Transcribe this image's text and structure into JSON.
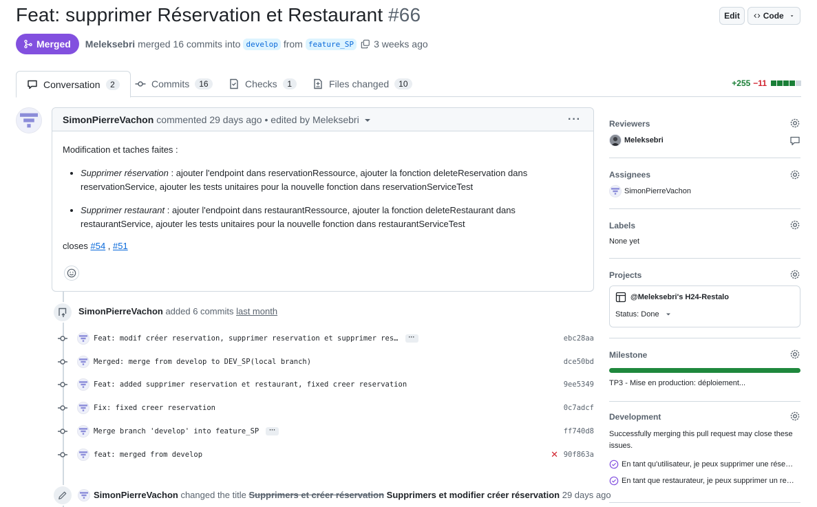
{
  "header": {
    "title": "Feat: supprimer Réservation et Restaurant",
    "number": "#66",
    "edit_label": "Edit",
    "code_label": "Code"
  },
  "pr_meta": {
    "state": "Merged",
    "author": "Meleksebri",
    "merged_text": "merged 16 commits into",
    "base_branch": "develop",
    "from_text": "from",
    "head_branch": "feature_SP",
    "time": "3 weeks ago"
  },
  "tabs": [
    {
      "label": "Conversation",
      "count": "2",
      "icon": "comment-icon",
      "active": true
    },
    {
      "label": "Commits",
      "count": "16",
      "icon": "commit-icon"
    },
    {
      "label": "Checks",
      "count": "1",
      "icon": "checklist-icon"
    },
    {
      "label": "Files changed",
      "count": "10",
      "icon": "file-diff-icon"
    }
  ],
  "diffstat": {
    "additions": "+255",
    "deletions": "−11"
  },
  "comment": {
    "author": "SimonPierreVachon",
    "action": "commented 29 days ago",
    "edited": "• edited by Meleksebri",
    "intro": "Modification et taches faites :",
    "items": [
      {
        "title": "Supprimer réservation",
        "text": " : ajouter l'endpoint dans reservationRessource, ajouter la fonction deleteReservation dans reservationService, ajouter les tests unitaires pour la nouvelle fonction dans reservationServiceTest"
      },
      {
        "title": "Supprimer restaurant",
        "text": " : ajouter l'endpoint dans restaurantRessource, ajouter la fonction deleteRestaurant dans restaurantService, ajouter les tests unitaires pour la nouvelle fonction dans restaurantServiceTest"
      }
    ],
    "closes_label": "closes",
    "issue1": "#54",
    "issue2": "#51"
  },
  "commits_event": {
    "author": "SimonPierreVachon",
    "text": "added 6 commits",
    "when": "last month"
  },
  "commits": [
    {
      "message": "Feat: modif créer reservation, supprimer reservation et supprimer res…",
      "sha": "ebc28aa",
      "more": true,
      "failed": false
    },
    {
      "message": "Merged: merge from develop to DEV_SP(local branch)",
      "sha": "dce50bd",
      "more": false,
      "failed": false
    },
    {
      "message": "Feat: added supprimer reservation et restaurant, fixed creer reservation",
      "sha": "9ee5349",
      "more": false,
      "failed": false
    },
    {
      "message": "Fix: fixed creer reservation",
      "sha": "0c7adcf",
      "more": false,
      "failed": false
    },
    {
      "message": "Merge branch 'develop' into feature_SP",
      "sha": "ff740d8",
      "more": true,
      "failed": false
    },
    {
      "message": "feat: merged from develop",
      "sha": "90f863a",
      "more": false,
      "failed": true
    }
  ],
  "rename_event": {
    "author": "SimonPierreVachon",
    "text": "changed the title",
    "old_title": "Supprimers et créer réservation",
    "new_title": "Supprimers et modifier créer réservation",
    "when": "29 days ago"
  },
  "sidebar": {
    "reviewers_label": "Reviewers",
    "reviewer": "Meleksebri",
    "assignees_label": "Assignees",
    "assignee": "SimonPierreVachon",
    "labels_label": "Labels",
    "labels_value": "None yet",
    "projects_label": "Projects",
    "project_name": "@Meleksebri's H24-Restalo",
    "project_status": "Status: Done",
    "milestone_label": "Milestone",
    "milestone_progress": 1.0,
    "milestone_name": "TP3 - Mise en production: déploiement...",
    "development_label": "Development",
    "development_text": "Successfully merging this pull request may close these issues.",
    "issues": [
      "En tant qu'utilisateur, je peux supprimer une rése…",
      "En tant que restaurateur, je peux supprimer un re…"
    ]
  },
  "colors": {
    "merged": "#8250df",
    "link": "#0969da",
    "add": "#1a7f37",
    "del": "#d1242f"
  }
}
